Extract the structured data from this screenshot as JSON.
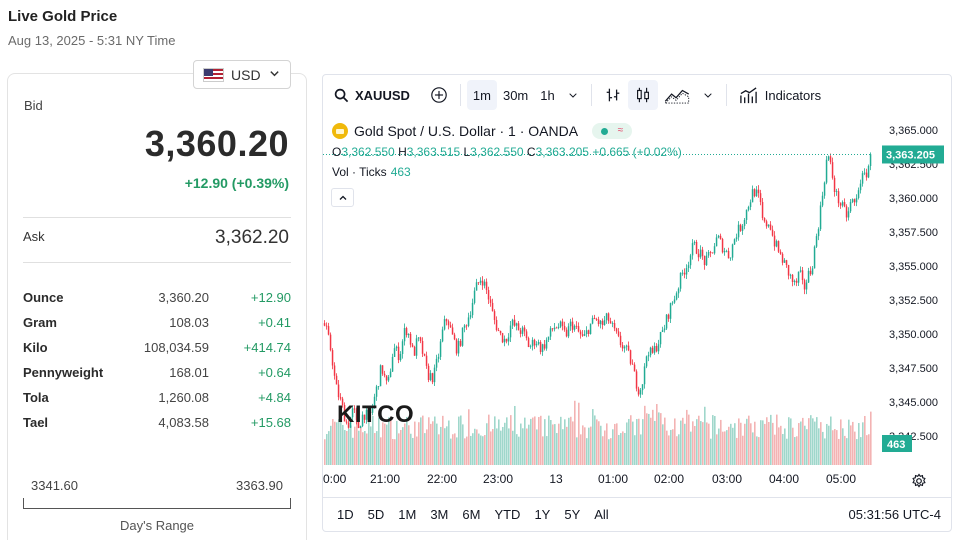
{
  "header": {
    "title": "Live Gold Price",
    "subtitle": "Aug 13, 2025 - 5:31 NY Time"
  },
  "currency": {
    "selected": "USD",
    "flag_icon": "us-flag-icon"
  },
  "bid": {
    "label": "Bid",
    "value": "3,360.20",
    "change": "+12.90 (+0.39%)"
  },
  "ask": {
    "label": "Ask",
    "value": "3,362.20"
  },
  "units": [
    {
      "name": "Ounce",
      "price": "3,360.20",
      "change": "+12.90"
    },
    {
      "name": "Gram",
      "price": "108.03",
      "change": "+0.41"
    },
    {
      "name": "Kilo",
      "price": "108,034.59",
      "change": "+414.74"
    },
    {
      "name": "Pennyweight",
      "price": "168.01",
      "change": "+0.64"
    },
    {
      "name": "Tola",
      "price": "1,260.08",
      "change": "+4.84"
    },
    {
      "name": "Tael",
      "price": "4,083.58",
      "change": "+15.68"
    }
  ],
  "days_range": {
    "low": "3341.60",
    "high": "3363.90",
    "label": "Day's Range"
  },
  "chart_widget": {
    "symbol": "XAUUSD",
    "intervals": [
      "1m",
      "30m",
      "1h"
    ],
    "active_interval": "1m",
    "indicators_label": "Indicators",
    "legend": {
      "instrument": "Gold Spot / U.S. Dollar · 1 · OANDA",
      "o_label": "O",
      "o": "3,362.550",
      "h_label": "H",
      "h": "3,363.515",
      "l_label": "L",
      "l": "3,362.550",
      "c_label": "C",
      "c": "3,363.205",
      "change": "+0.665 (+0.02%)",
      "vol_label": "Vol · Ticks",
      "vol_value": "463"
    },
    "watermark": "KITCO",
    "last_price_tag": "3,363.205",
    "last_volume_tag": "463",
    "range_buttons": [
      "1D",
      "5D",
      "1M",
      "3M",
      "6M",
      "YTD",
      "1Y",
      "5Y",
      "All"
    ],
    "clock": "05:31:56 UTC-4",
    "colors": {
      "up": "#22ab94",
      "down": "#f23645",
      "up_vol": "#9fd7cb",
      "down_vol": "#f3b3b3"
    }
  },
  "chart_data": {
    "type": "candlestick",
    "x_ticks": [
      "0:00",
      "21:00",
      "22:00",
      "23:00",
      "13",
      "01:00",
      "02:00",
      "03:00",
      "04:00",
      "05:00"
    ],
    "y_ticks": [
      "3,365.000",
      "3,362.500",
      "3,360.000",
      "3,357.500",
      "3,355.000",
      "3,352.500",
      "3,350.000",
      "3,347.500",
      "3,345.000",
      "3,342.500"
    ],
    "ylim": [
      3341.5,
      3365.5
    ],
    "close_path": [
      [
        0,
        3350.8
      ],
      [
        3,
        3350.2
      ],
      [
        8,
        3348.6
      ],
      [
        12,
        3346.2
      ],
      [
        18,
        3344.8
      ],
      [
        24,
        3343.2
      ],
      [
        30,
        3344.5
      ],
      [
        34,
        3343.0
      ],
      [
        40,
        3344.2
      ],
      [
        46,
        3343.8
      ],
      [
        52,
        3345.6
      ],
      [
        58,
        3347.6
      ],
      [
        64,
        3346.0
      ],
      [
        70,
        3349.0
      ],
      [
        76,
        3348.4
      ],
      [
        82,
        3350.5
      ],
      [
        86,
        3349.8
      ],
      [
        90,
        3348.4
      ],
      [
        94,
        3349.6
      ],
      [
        98,
        3349.0
      ],
      [
        104,
        3347.0
      ],
      [
        110,
        3346.8
      ],
      [
        116,
        3348.8
      ],
      [
        120,
        3350.6
      ],
      [
        124,
        3351.2
      ],
      [
        128,
        3350.0
      ],
      [
        134,
        3348.8
      ],
      [
        140,
        3350.3
      ],
      [
        146,
        3351.5
      ],
      [
        152,
        3353.3
      ],
      [
        158,
        3354.2
      ],
      [
        164,
        3353.0
      ],
      [
        170,
        3351.2
      ],
      [
        176,
        3350.0
      ],
      [
        182,
        3349.5
      ],
      [
        188,
        3350.8
      ],
      [
        194,
        3350.4
      ],
      [
        200,
        3350.1
      ],
      [
        206,
        3349.0
      ],
      [
        212,
        3349.6
      ],
      [
        218,
        3348.9
      ],
      [
        224,
        3349.6
      ],
      [
        230,
        3350.5
      ],
      [
        236,
        3350.6
      ],
      [
        242,
        3349.9
      ],
      [
        248,
        3350.8
      ],
      [
        254,
        3350.2
      ],
      [
        260,
        3349.6
      ],
      [
        266,
        3350.6
      ],
      [
        272,
        3351.1
      ],
      [
        278,
        3350.6
      ],
      [
        284,
        3351.2
      ],
      [
        290,
        3350.3
      ],
      [
        296,
        3349.4
      ],
      [
        302,
        3348.9
      ],
      [
        308,
        3347.9
      ],
      [
        312,
        3346.6
      ],
      [
        316,
        3345.8
      ],
      [
        320,
        3346.8
      ],
      [
        324,
        3349.0
      ],
      [
        328,
        3348.4
      ],
      [
        334,
        3349.3
      ],
      [
        340,
        3350.3
      ],
      [
        346,
        3351.8
      ],
      [
        352,
        3352.9
      ],
      [
        358,
        3354.3
      ],
      [
        364,
        3355.2
      ],
      [
        370,
        3356.5
      ],
      [
        376,
        3356.0
      ],
      [
        382,
        3355.2
      ],
      [
        388,
        3356.0
      ],
      [
        394,
        3357.1
      ],
      [
        400,
        3356.3
      ],
      [
        406,
        3355.7
      ],
      [
        412,
        3357.3
      ],
      [
        418,
        3358.0
      ],
      [
        424,
        3359.3
      ],
      [
        430,
        3360.6
      ],
      [
        436,
        3359.9
      ],
      [
        440,
        3357.9
      ],
      [
        446,
        3358.3
      ],
      [
        450,
        3356.9
      ],
      [
        456,
        3355.9
      ],
      [
        462,
        3355.0
      ],
      [
        468,
        3354.0
      ],
      [
        472,
        3353.5
      ],
      [
        476,
        3354.6
      ],
      [
        480,
        3353.2
      ],
      [
        484,
        3354.2
      ],
      [
        488,
        3354.8
      ],
      [
        492,
        3356.7
      ],
      [
        496,
        3358.6
      ],
      [
        500,
        3360.9
      ],
      [
        504,
        3363.3
      ],
      [
        508,
        3362.0
      ],
      [
        512,
        3360.3
      ],
      [
        518,
        3359.4
      ],
      [
        524,
        3358.6
      ],
      [
        528,
        3359.9
      ],
      [
        532,
        3359.4
      ],
      [
        536,
        3361.3
      ],
      [
        542,
        3361.6
      ],
      [
        548,
        3363.2
      ]
    ]
  }
}
